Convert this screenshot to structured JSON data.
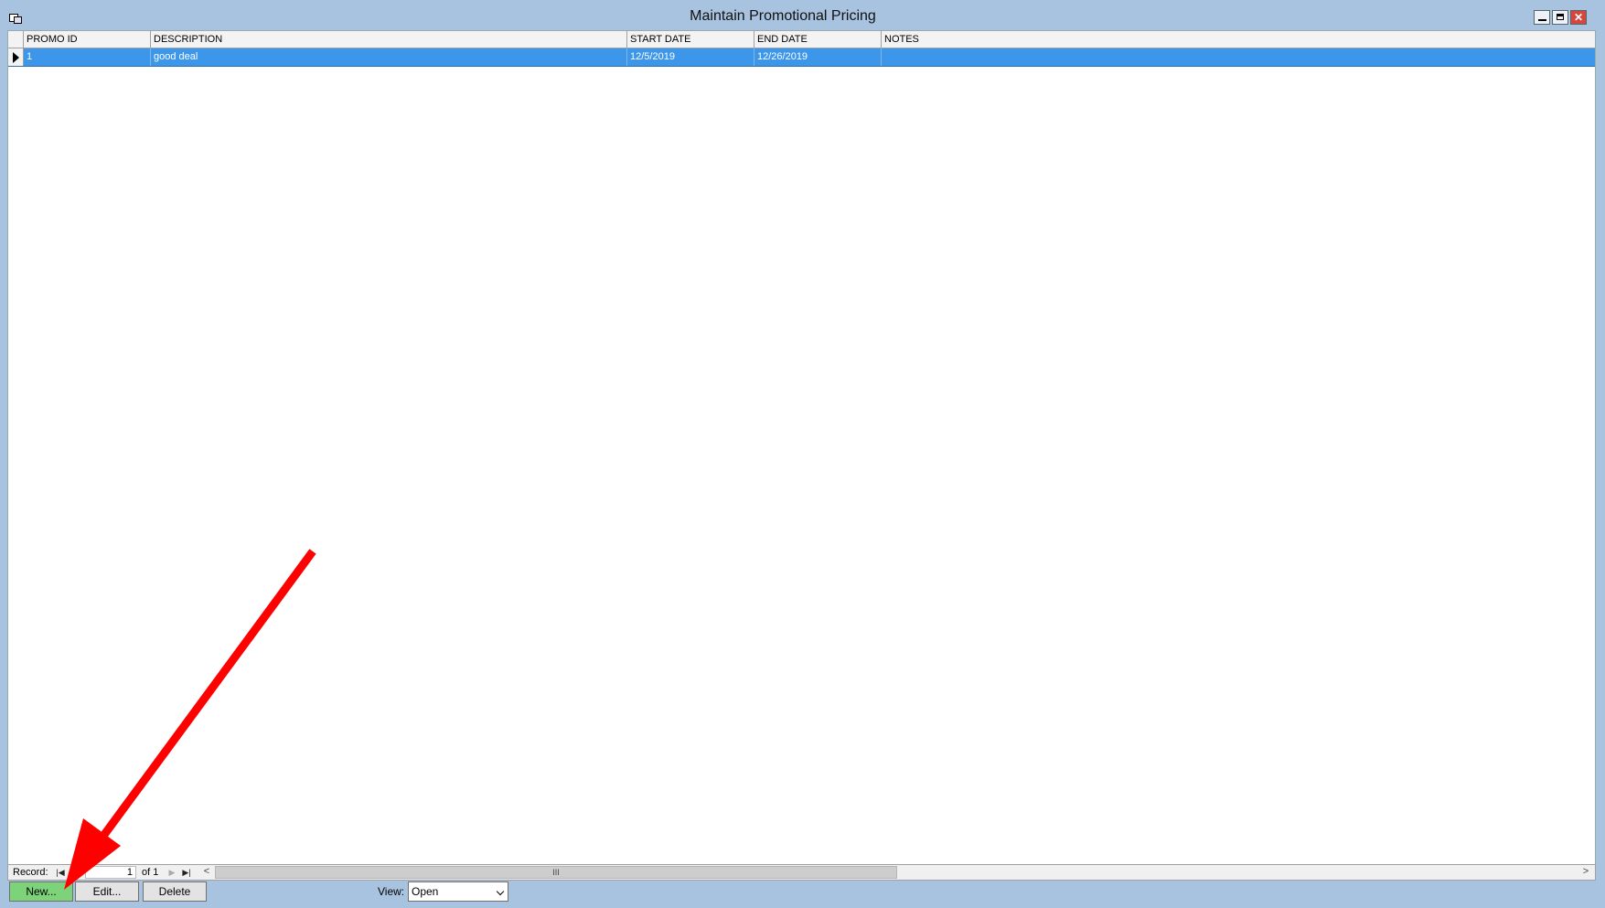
{
  "window": {
    "title": "Maintain Promotional Pricing",
    "icons": {
      "app": "window-app-icon",
      "minimize": "minimize-icon",
      "maximize": "maximize-icon",
      "close": "close-icon"
    }
  },
  "grid": {
    "columns": [
      "PROMO ID",
      "DESCRIPTION",
      "START DATE",
      "END DATE",
      "NOTES"
    ],
    "rows": [
      {
        "promo_id": "1",
        "description": "good deal",
        "start_date": "12/5/2019",
        "end_date": "12/26/2019",
        "notes": ""
      }
    ],
    "selected_row": 0
  },
  "navigation": {
    "record_label": "Record:",
    "current": "1",
    "of_label": "of 1",
    "icons": {
      "first": "first-record-icon",
      "prev": "previous-record-icon",
      "next": "next-record-icon",
      "last": "last-record-icon"
    },
    "scroll_thumb_grip": "III",
    "scroll_left": "<",
    "scroll_right": ">"
  },
  "toolbar": {
    "new_label": "New...",
    "edit_label": "Edit...",
    "delete_label": "Delete",
    "view_label": "View:",
    "view_value": "Open"
  },
  "colors": {
    "window_frame": "#a8c3df",
    "selected_row": "#3c96ea",
    "new_button": "#7dd37a",
    "annotation_arrow": "#ff0000"
  }
}
